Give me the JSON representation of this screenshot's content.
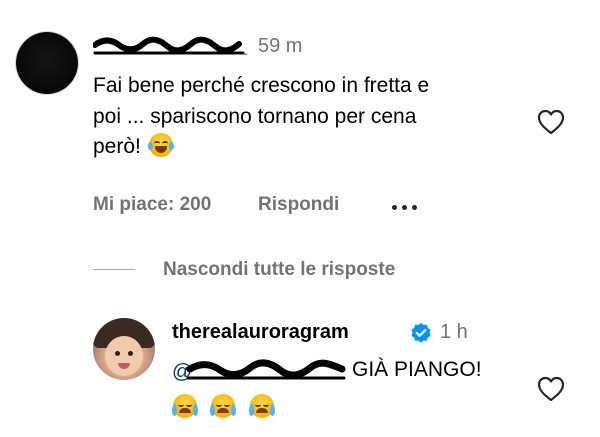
{
  "comment": {
    "username_suffix": "_",
    "time": "59 m",
    "text_lines": [
      "Fai bene perché crescono in fretta e",
      "poi ... spariscono tornano per cena",
      "però!"
    ],
    "emoji": "face-with-tears-of-joy",
    "likes_label": "Mi piace: 200",
    "reply_label": "Rispondi",
    "more_icon": "more-horizontal-icon",
    "like_icon": "heart-outline-icon"
  },
  "thread": {
    "hide_replies_label": "Nascondi tutte le risposte"
  },
  "reply": {
    "username": "therealauroragram",
    "verified_icon": "verified-badge-icon",
    "verified_color": "#0095f6",
    "time": "1 h",
    "mention_prefix": "@",
    "text": "GIÀ PIANGO!",
    "emojis": [
      "loudly-crying-face",
      "loudly-crying-face",
      "loudly-crying-face"
    ],
    "like_icon": "heart-outline-icon"
  },
  "colors": {
    "secondary_text": "#737373",
    "primary_text": "#000000",
    "divider": "#a8a8a8"
  }
}
